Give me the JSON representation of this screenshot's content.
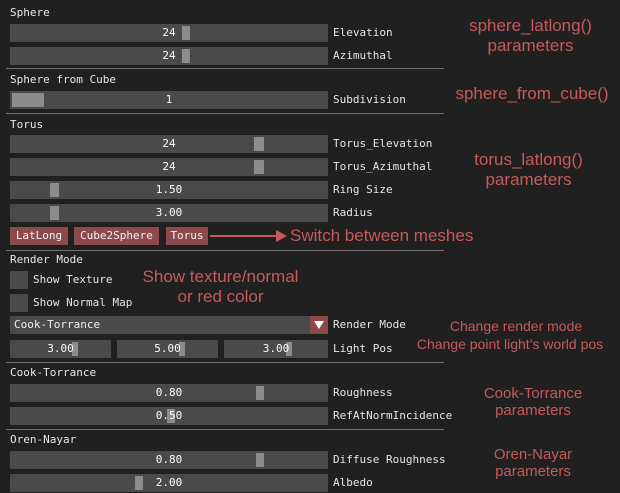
{
  "sections": {
    "sphere": {
      "header": "Sphere",
      "elevation": {
        "label": "Elevation",
        "value": "24"
      },
      "azimuthal": {
        "label": "Azimuthal",
        "value": "24"
      }
    },
    "sphere_from_cube": {
      "header": "Sphere from Cube",
      "subdivision": {
        "label": "Subdivision",
        "value": "1"
      }
    },
    "torus": {
      "header": "Torus",
      "torus_elevation": {
        "label": "Torus_Elevation",
        "value": "24"
      },
      "torus_azimuthal": {
        "label": "Torus_Azimuthal",
        "value": "24"
      },
      "ring_size": {
        "label": "Ring Size",
        "value": "1.50"
      },
      "radius": {
        "label": "Radius",
        "value": "3.00"
      }
    },
    "mesh_buttons": [
      "LatLong",
      "Cube2Sphere",
      "Torus"
    ],
    "render_mode": {
      "header": "Render Mode",
      "show_texture": "Show Texture",
      "show_normal_map": "Show Normal Map",
      "combo_value": "Cook-Torrance",
      "combo_label": "Render Mode",
      "light_pos": {
        "label": "Light Pos",
        "values": [
          "3.00",
          "5.00",
          "3.00"
        ]
      }
    },
    "cook_torrance": {
      "header": "Cook-Torrance",
      "roughness": {
        "label": "Roughness",
        "value": "0.80"
      },
      "ref": {
        "label": "RefAtNormIncidence",
        "value": "0.50"
      }
    },
    "oren_nayar": {
      "header": "Oren-Nayar",
      "diffuse_roughness": {
        "label": "Diffuse Roughness",
        "value": "0.80"
      },
      "albedo": {
        "label": "Albedo",
        "value": "2.00"
      }
    }
  },
  "annotations": {
    "sphere_latlong": "sphere_latlong()\nparameters",
    "sphere_from_cube": "sphere_from_cube()",
    "torus_latlong": "torus_latlong()\nparameters",
    "switch_meshes": "Switch between meshes",
    "show_texture": "Show texture/normal\nor red color",
    "change_render_mode": "Change render mode",
    "change_light_pos": "Change point light's world pos",
    "cook_torrance_params": "Cook-Torrance\nparameters",
    "oren_nayar_params": "Oren-Nayar\nparameters"
  },
  "colors": {
    "accent": "#8d4a4a",
    "annotation": "#c75a5a",
    "background": "#202020",
    "frame": "#4a4a4a"
  }
}
